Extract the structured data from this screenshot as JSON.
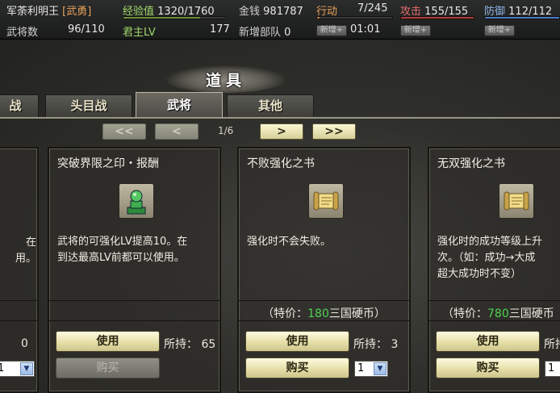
{
  "status": {
    "player_name": "军荼利明王",
    "player_class": "[武勇]",
    "exp_label": "经验值",
    "exp_value": "1320/1760",
    "exp_fraction": 0.75,
    "money_label": "金钱",
    "money_value": "981787",
    "action_label": "行动",
    "action_value": "7/245",
    "action_fraction": 0.03,
    "attack_label": "攻击",
    "attack_value": "155/155",
    "attack_fraction": 1.0,
    "defense_label": "防御",
    "defense_value": "112/112",
    "defense_fraction": 1.0,
    "generals_label": "武将数",
    "generals_value": "96/110",
    "lord_level_label": "君主LV",
    "lord_level_value": "177",
    "new_units_label": "新增部队",
    "new_units_value": "0",
    "timer": "01:01",
    "add_button_label": "新增+"
  },
  "panel": {
    "title": "道具",
    "tabs": [
      {
        "label": "战"
      },
      {
        "label": "头目战"
      },
      {
        "label": "武将"
      },
      {
        "label": "其他"
      }
    ],
    "active_tab": 2,
    "pagination": {
      "first": "<<",
      "prev": "<",
      "page": "1/6",
      "next": ">",
      "last": ">>"
    }
  },
  "cards": [
    {
      "name": "",
      "desc": [
        "在",
        "用。"
      ],
      "owned": "0",
      "quantity": "1"
    },
    {
      "name": "突破界限之印・报酬",
      "icon": "jade-seal-icon",
      "desc": [
        "武将的可强化LV提高10。在",
        "到达最高LV前都可以使用。"
      ],
      "use_label": "使用",
      "buy_label": "购买",
      "owned_label": "所持：",
      "owned": "65"
    },
    {
      "name": "不败强化之书",
      "icon": "scroll-icon",
      "desc": [
        "强化时不会失败。"
      ],
      "price_prefix": "（特价：",
      "price": "180",
      "price_suffix": "三国硬币）",
      "use_label": "使用",
      "buy_label": "购买",
      "owned_label": "所持：",
      "owned": "3",
      "quantity": "1"
    },
    {
      "name": "无双强化之书",
      "icon": "scroll-icon",
      "desc": [
        "强化时的成功等级上升",
        "次。（如：成功→大成",
        "超大成功时不变）"
      ],
      "price_prefix": "（特价：",
      "price": "780",
      "price_suffix": "三国硬币",
      "use_label": "使用",
      "buy_label": "购买",
      "owned_label": "所持",
      "quantity": "1"
    }
  ],
  "colors": {
    "exp_bar": "#6c8f3a",
    "action_bar": "#c97a2a",
    "attack_bar": "#b53a3a",
    "defense_bar": "#4a79c8",
    "price_green": "#4fd24f"
  }
}
